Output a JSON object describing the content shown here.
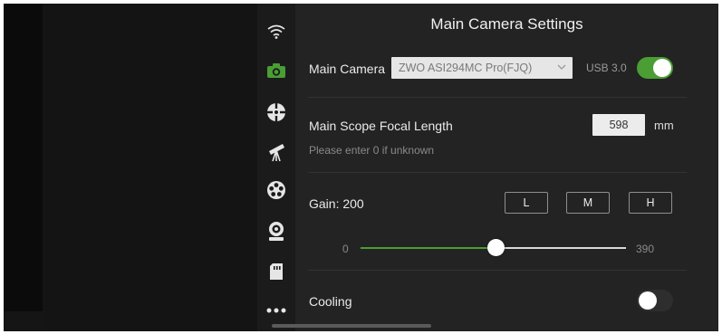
{
  "panel": {
    "title": "Main Camera Settings"
  },
  "sidebar": {
    "icons": [
      "wifi-icon",
      "camera-icon",
      "target-icon",
      "telescope-icon",
      "filter-wheel-icon",
      "webcam-icon",
      "sd-card-icon",
      "more-icon"
    ],
    "active": "camera-icon"
  },
  "main_camera": {
    "label": "Main Camera",
    "selected": "ZWO ASI294MC Pro(FJQ)",
    "connection": "USB 3.0",
    "enabled": true
  },
  "focal_length": {
    "label": "Main Scope Focal Length",
    "value": "598",
    "unit": "mm",
    "hint": "Please enter 0 if unknown"
  },
  "gain": {
    "label": "Gain: 200",
    "presets": [
      "L",
      "M",
      "H"
    ],
    "min": "0",
    "max": "390",
    "value": 200
  },
  "cooling": {
    "label": "Cooling",
    "enabled": false
  },
  "colors": {
    "accent": "#4a9e34",
    "panel": "#232323",
    "rail": "#1b1b1b"
  }
}
